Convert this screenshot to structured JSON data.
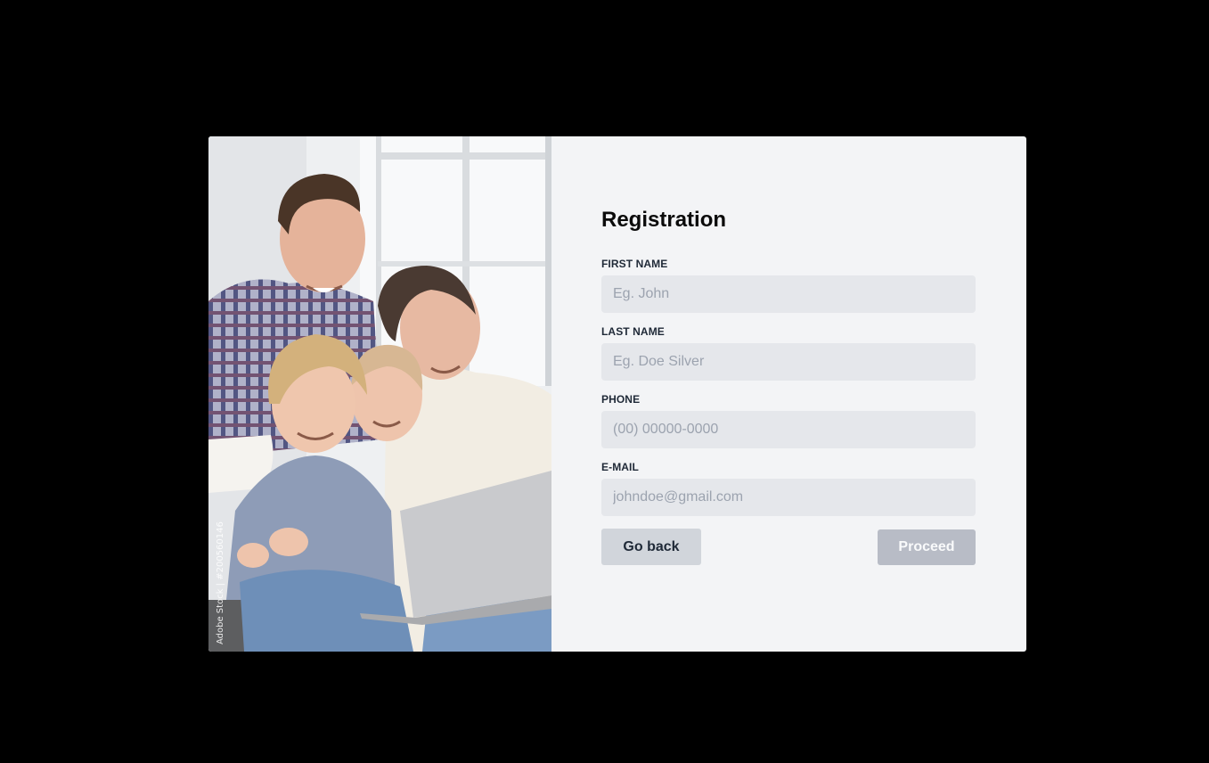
{
  "photo": {
    "alt": "Family of four smiling at a laptop",
    "watermark": "Adobe Stock | #200560146"
  },
  "form": {
    "title": "Registration",
    "fields": [
      {
        "label": "FIRST NAME",
        "placeholder": "Eg. John",
        "value": ""
      },
      {
        "label": "LAST NAME",
        "placeholder": "Eg. Doe Silver",
        "value": ""
      },
      {
        "label": "PHONE",
        "placeholder": "(00) 00000-0000",
        "value": ""
      },
      {
        "label": "E-MAIL",
        "placeholder": "johndoe@gmail.com",
        "value": ""
      }
    ],
    "back_label": "Go back",
    "proceed_label": "Proceed"
  },
  "colors": {
    "page_background": "#000000",
    "card_background": "#f3f4f6",
    "input_background": "#e5e7eb",
    "back_button": "#d1d5db",
    "proceed_button_disabled": "#b8bcc6"
  }
}
